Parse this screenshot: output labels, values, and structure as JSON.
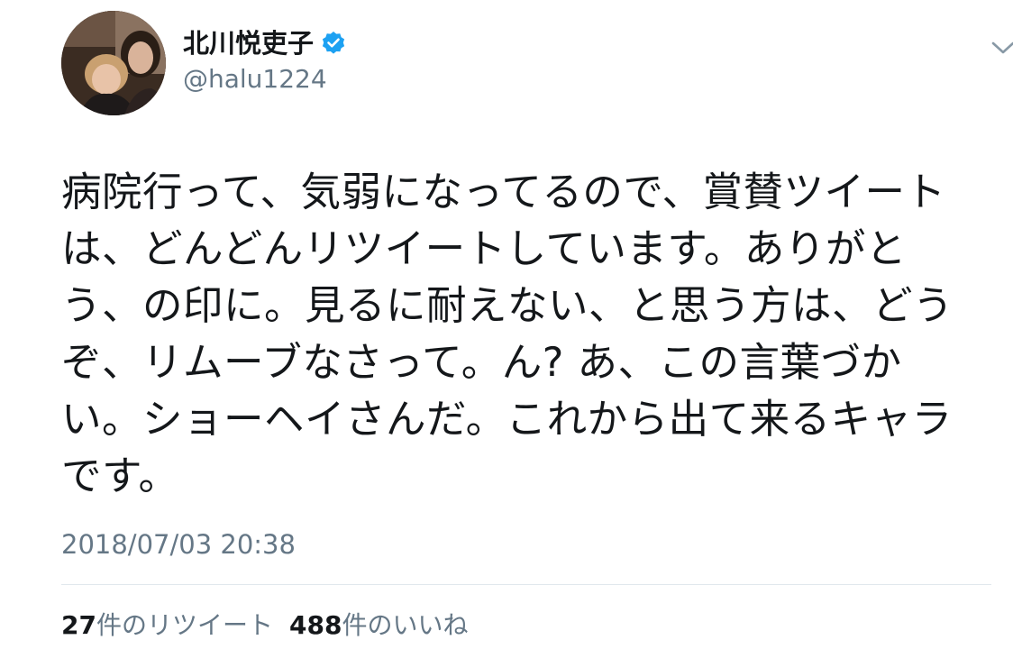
{
  "tweet": {
    "author": {
      "display_name": "北川悦吏子",
      "handle": "@halu1224",
      "verified": true,
      "avatar_icon": "profile-photo"
    },
    "menu_icon": "chevron-down-icon",
    "text": "病院行って、気弱になってるので、賞賛ツイート\nは、どんどんリツイートしています。ありがと\nう、の印に。見るに耐えない、と思う方は、どう\nぞ、リムーブなさって。ん? あ、この言葉づか\nい。ショーヘイさんだ。これから出て来るキャラ\nです。",
    "timestamp": "2018/07/03 20:38",
    "stats": {
      "retweets": {
        "count": "27",
        "label": "件のリツイート"
      },
      "likes": {
        "count": "488",
        "label": "件のいいね"
      }
    }
  },
  "colors": {
    "text_primary": "#14171a",
    "text_secondary": "#657786",
    "verified_blue": "#1da1f2",
    "divider": "#e1e8ed"
  }
}
